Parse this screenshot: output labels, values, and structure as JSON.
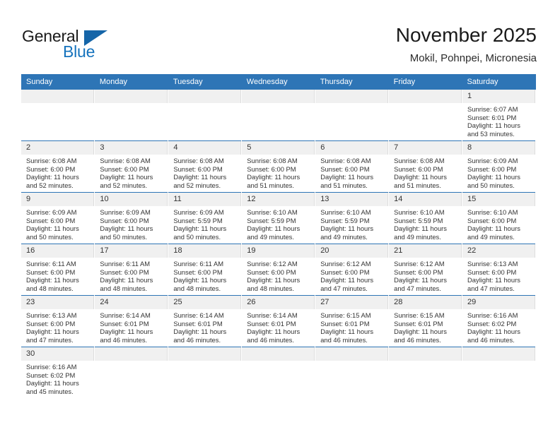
{
  "brand": {
    "name_part1": "General",
    "name_part2": "Blue",
    "flag_icon": "blue-triangle-flag"
  },
  "header": {
    "title": "November 2025",
    "subtitle": "Mokil, Pohnpei, Micronesia"
  },
  "colors": {
    "header_bar": "#2e75b6",
    "brand_blue": "#1673bd",
    "daynum_band": "#f0f0f0",
    "row_divider": "#2e75b6"
  },
  "weekday_headers": [
    "Sunday",
    "Monday",
    "Tuesday",
    "Wednesday",
    "Thursday",
    "Friday",
    "Saturday"
  ],
  "labels": {
    "sunrise": "Sunrise:",
    "sunset": "Sunset:",
    "daylight": "Daylight:"
  },
  "weeks": [
    [
      {
        "day": "",
        "empty": true
      },
      {
        "day": "",
        "empty": true
      },
      {
        "day": "",
        "empty": true
      },
      {
        "day": "",
        "empty": true
      },
      {
        "day": "",
        "empty": true
      },
      {
        "day": "",
        "empty": true
      },
      {
        "day": "1",
        "sunrise": "Sunrise: 6:07 AM",
        "sunset": "Sunset: 6:01 PM",
        "daylight_1": "Daylight: 11 hours",
        "daylight_2": "and 53 minutes."
      }
    ],
    [
      {
        "day": "2",
        "sunrise": "Sunrise: 6:08 AM",
        "sunset": "Sunset: 6:00 PM",
        "daylight_1": "Daylight: 11 hours",
        "daylight_2": "and 52 minutes."
      },
      {
        "day": "3",
        "sunrise": "Sunrise: 6:08 AM",
        "sunset": "Sunset: 6:00 PM",
        "daylight_1": "Daylight: 11 hours",
        "daylight_2": "and 52 minutes."
      },
      {
        "day": "4",
        "sunrise": "Sunrise: 6:08 AM",
        "sunset": "Sunset: 6:00 PM",
        "daylight_1": "Daylight: 11 hours",
        "daylight_2": "and 52 minutes."
      },
      {
        "day": "5",
        "sunrise": "Sunrise: 6:08 AM",
        "sunset": "Sunset: 6:00 PM",
        "daylight_1": "Daylight: 11 hours",
        "daylight_2": "and 51 minutes."
      },
      {
        "day": "6",
        "sunrise": "Sunrise: 6:08 AM",
        "sunset": "Sunset: 6:00 PM",
        "daylight_1": "Daylight: 11 hours",
        "daylight_2": "and 51 minutes."
      },
      {
        "day": "7",
        "sunrise": "Sunrise: 6:08 AM",
        "sunset": "Sunset: 6:00 PM",
        "daylight_1": "Daylight: 11 hours",
        "daylight_2": "and 51 minutes."
      },
      {
        "day": "8",
        "sunrise": "Sunrise: 6:09 AM",
        "sunset": "Sunset: 6:00 PM",
        "daylight_1": "Daylight: 11 hours",
        "daylight_2": "and 50 minutes."
      }
    ],
    [
      {
        "day": "9",
        "sunrise": "Sunrise: 6:09 AM",
        "sunset": "Sunset: 6:00 PM",
        "daylight_1": "Daylight: 11 hours",
        "daylight_2": "and 50 minutes."
      },
      {
        "day": "10",
        "sunrise": "Sunrise: 6:09 AM",
        "sunset": "Sunset: 6:00 PM",
        "daylight_1": "Daylight: 11 hours",
        "daylight_2": "and 50 minutes."
      },
      {
        "day": "11",
        "sunrise": "Sunrise: 6:09 AM",
        "sunset": "Sunset: 5:59 PM",
        "daylight_1": "Daylight: 11 hours",
        "daylight_2": "and 50 minutes."
      },
      {
        "day": "12",
        "sunrise": "Sunrise: 6:10 AM",
        "sunset": "Sunset: 5:59 PM",
        "daylight_1": "Daylight: 11 hours",
        "daylight_2": "and 49 minutes."
      },
      {
        "day": "13",
        "sunrise": "Sunrise: 6:10 AM",
        "sunset": "Sunset: 5:59 PM",
        "daylight_1": "Daylight: 11 hours",
        "daylight_2": "and 49 minutes."
      },
      {
        "day": "14",
        "sunrise": "Sunrise: 6:10 AM",
        "sunset": "Sunset: 5:59 PM",
        "daylight_1": "Daylight: 11 hours",
        "daylight_2": "and 49 minutes."
      },
      {
        "day": "15",
        "sunrise": "Sunrise: 6:10 AM",
        "sunset": "Sunset: 6:00 PM",
        "daylight_1": "Daylight: 11 hours",
        "daylight_2": "and 49 minutes."
      }
    ],
    [
      {
        "day": "16",
        "sunrise": "Sunrise: 6:11 AM",
        "sunset": "Sunset: 6:00 PM",
        "daylight_1": "Daylight: 11 hours",
        "daylight_2": "and 48 minutes."
      },
      {
        "day": "17",
        "sunrise": "Sunrise: 6:11 AM",
        "sunset": "Sunset: 6:00 PM",
        "daylight_1": "Daylight: 11 hours",
        "daylight_2": "and 48 minutes."
      },
      {
        "day": "18",
        "sunrise": "Sunrise: 6:11 AM",
        "sunset": "Sunset: 6:00 PM",
        "daylight_1": "Daylight: 11 hours",
        "daylight_2": "and 48 minutes."
      },
      {
        "day": "19",
        "sunrise": "Sunrise: 6:12 AM",
        "sunset": "Sunset: 6:00 PM",
        "daylight_1": "Daylight: 11 hours",
        "daylight_2": "and 48 minutes."
      },
      {
        "day": "20",
        "sunrise": "Sunrise: 6:12 AM",
        "sunset": "Sunset: 6:00 PM",
        "daylight_1": "Daylight: 11 hours",
        "daylight_2": "and 47 minutes."
      },
      {
        "day": "21",
        "sunrise": "Sunrise: 6:12 AM",
        "sunset": "Sunset: 6:00 PM",
        "daylight_1": "Daylight: 11 hours",
        "daylight_2": "and 47 minutes."
      },
      {
        "day": "22",
        "sunrise": "Sunrise: 6:13 AM",
        "sunset": "Sunset: 6:00 PM",
        "daylight_1": "Daylight: 11 hours",
        "daylight_2": "and 47 minutes."
      }
    ],
    [
      {
        "day": "23",
        "sunrise": "Sunrise: 6:13 AM",
        "sunset": "Sunset: 6:00 PM",
        "daylight_1": "Daylight: 11 hours",
        "daylight_2": "and 47 minutes."
      },
      {
        "day": "24",
        "sunrise": "Sunrise: 6:14 AM",
        "sunset": "Sunset: 6:01 PM",
        "daylight_1": "Daylight: 11 hours",
        "daylight_2": "and 46 minutes."
      },
      {
        "day": "25",
        "sunrise": "Sunrise: 6:14 AM",
        "sunset": "Sunset: 6:01 PM",
        "daylight_1": "Daylight: 11 hours",
        "daylight_2": "and 46 minutes."
      },
      {
        "day": "26",
        "sunrise": "Sunrise: 6:14 AM",
        "sunset": "Sunset: 6:01 PM",
        "daylight_1": "Daylight: 11 hours",
        "daylight_2": "and 46 minutes."
      },
      {
        "day": "27",
        "sunrise": "Sunrise: 6:15 AM",
        "sunset": "Sunset: 6:01 PM",
        "daylight_1": "Daylight: 11 hours",
        "daylight_2": "and 46 minutes."
      },
      {
        "day": "28",
        "sunrise": "Sunrise: 6:15 AM",
        "sunset": "Sunset: 6:01 PM",
        "daylight_1": "Daylight: 11 hours",
        "daylight_2": "and 46 minutes."
      },
      {
        "day": "29",
        "sunrise": "Sunrise: 6:16 AM",
        "sunset": "Sunset: 6:02 PM",
        "daylight_1": "Daylight: 11 hours",
        "daylight_2": "and 46 minutes."
      }
    ],
    [
      {
        "day": "30",
        "sunrise": "Sunrise: 6:16 AM",
        "sunset": "Sunset: 6:02 PM",
        "daylight_1": "Daylight: 11 hours",
        "daylight_2": "and 45 minutes."
      },
      {
        "day": "",
        "empty": true
      },
      {
        "day": "",
        "empty": true
      },
      {
        "day": "",
        "empty": true
      },
      {
        "day": "",
        "empty": true
      },
      {
        "day": "",
        "empty": true
      },
      {
        "day": "",
        "empty": true
      }
    ]
  ]
}
